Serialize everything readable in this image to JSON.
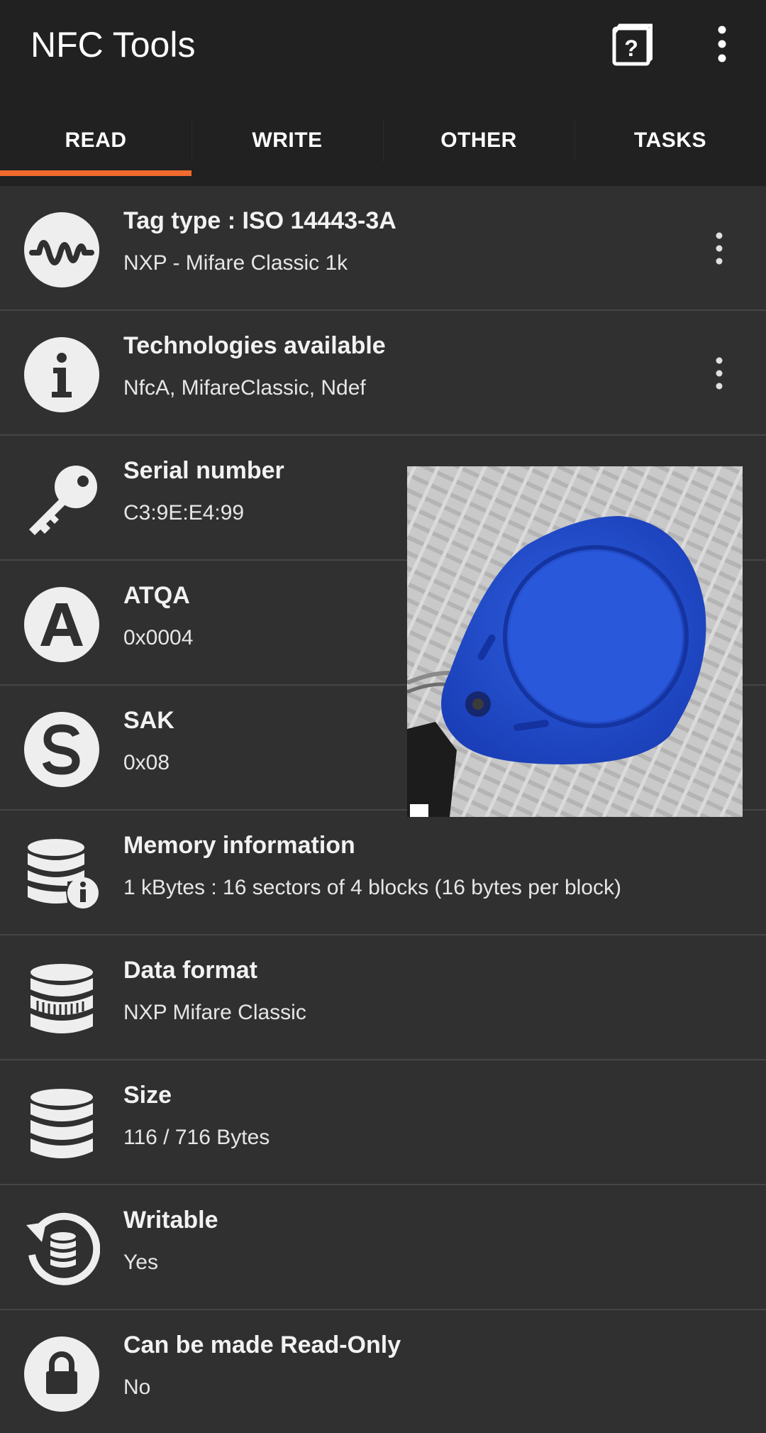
{
  "app": {
    "title": "NFC Tools"
  },
  "toolbar": {
    "help_icon": "help-book-icon",
    "menu_icon": "more-vert-icon"
  },
  "tabs": [
    {
      "label": "READ",
      "active": true
    },
    {
      "label": "WRITE",
      "active": false
    },
    {
      "label": "OTHER",
      "active": false
    },
    {
      "label": "TASKS",
      "active": false
    }
  ],
  "rows": [
    {
      "title": "Tag type : ISO 14443-3A",
      "value": "NXP - Mifare Classic 1k",
      "icon": "wave-icon",
      "has_menu": true
    },
    {
      "title": "Technologies available",
      "value": "NfcA, MifareClassic, Ndef",
      "icon": "info-icon",
      "has_menu": true
    },
    {
      "title": "Serial number",
      "value": "C3:9E:E4:99",
      "icon": "key-icon",
      "has_menu": false
    },
    {
      "title": "ATQA",
      "value": "0x0004",
      "icon": "letter-a-icon",
      "has_menu": false
    },
    {
      "title": "SAK",
      "value": "0x08",
      "icon": "letter-s-icon",
      "has_menu": false
    },
    {
      "title": "Memory information",
      "value": "1 kBytes : 16 sectors of 4 blocks (16 bytes per block)",
      "icon": "database-info-icon",
      "has_menu": false
    },
    {
      "title": "Data format",
      "value": "NXP Mifare Classic",
      "icon": "database-striped-icon",
      "has_menu": false
    },
    {
      "title": "Size",
      "value": "116 / 716 Bytes",
      "icon": "database-icon",
      "has_menu": false
    },
    {
      "title": "Writable",
      "value": "Yes",
      "icon": "database-refresh-icon",
      "has_menu": false
    },
    {
      "title": "Can be made Read-Only",
      "value": "No",
      "icon": "lock-icon",
      "has_menu": false
    }
  ],
  "overlay_photo": {
    "subject": "blue-rfid-keyfob-photo"
  },
  "colors": {
    "background": "#303030",
    "appbar": "#212121",
    "accent": "#f26a2e",
    "icon_circle": "#eeeeee"
  }
}
